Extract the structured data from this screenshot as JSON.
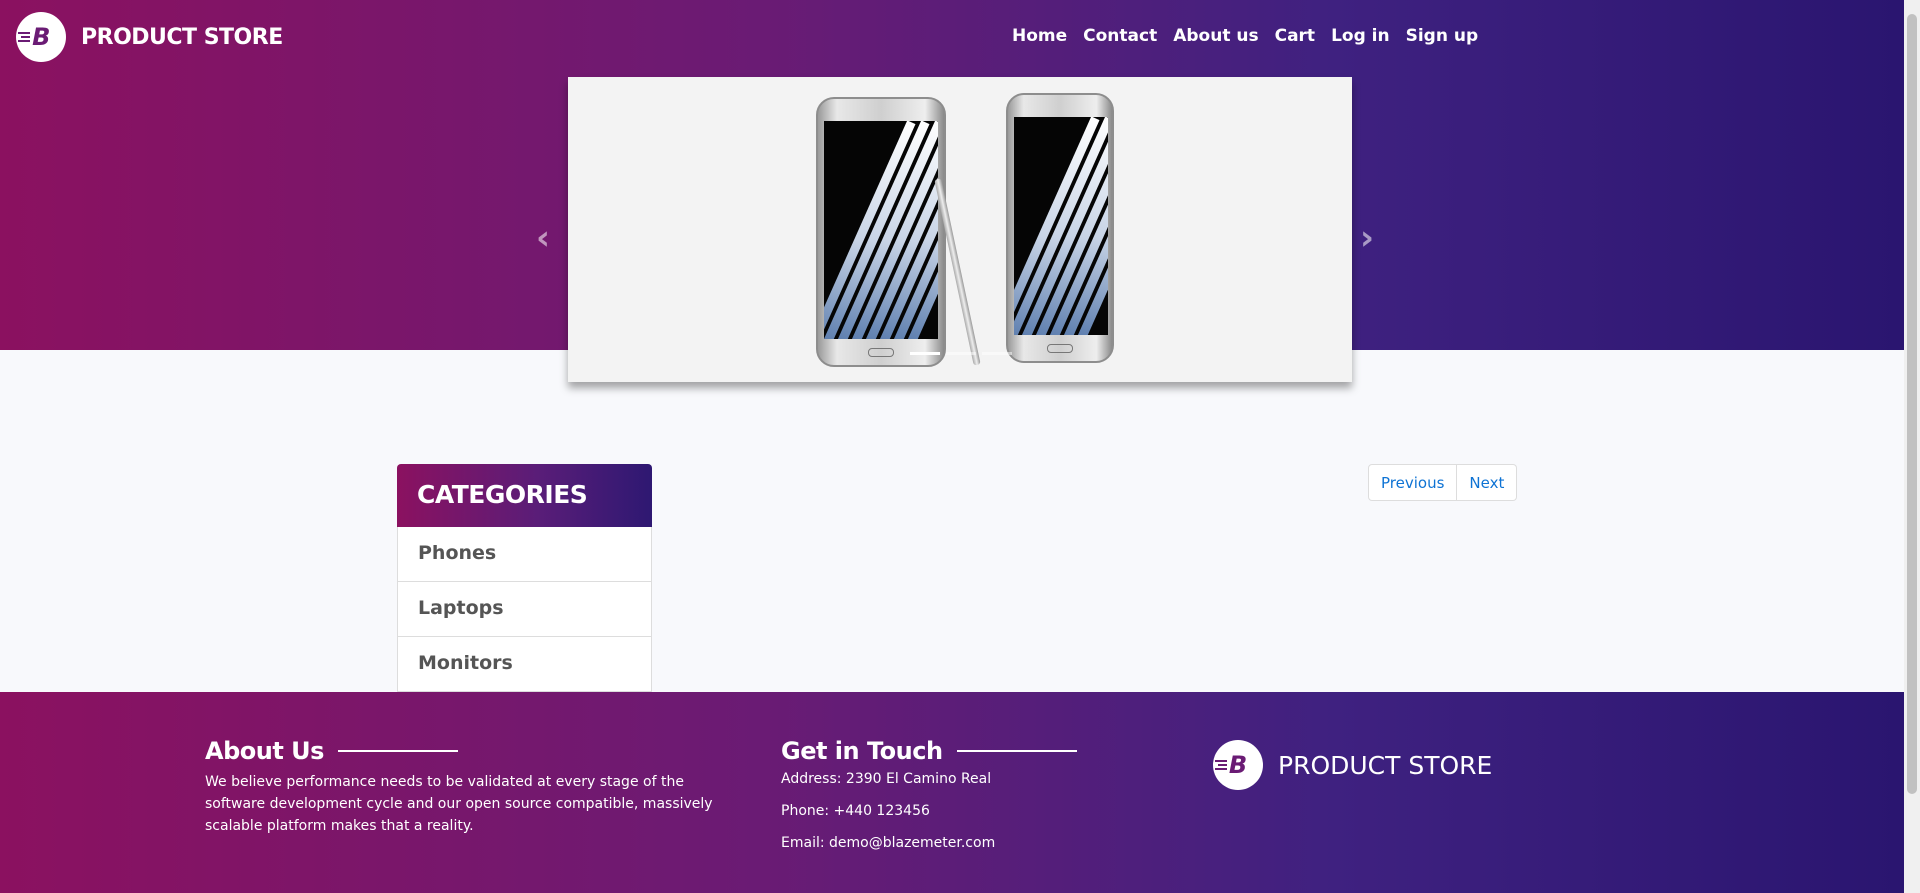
{
  "header": {
    "brand": "PRODUCT STORE",
    "logo_letter": "B",
    "nav": [
      "Home",
      "Contact",
      "About us",
      "Cart",
      "Log in",
      "Sign up"
    ]
  },
  "carousel": {
    "prev_icon": "chevron-left-icon",
    "next_icon": "chevron-right-icon",
    "prev_glyph": "‹",
    "next_glyph": "›"
  },
  "categories": {
    "title": "CATEGORIES",
    "items": [
      "Phones",
      "Laptops",
      "Monitors"
    ]
  },
  "pagination": {
    "previous": "Previous",
    "next": "Next"
  },
  "footer": {
    "about_title": "About Us",
    "about_text": "We believe performance needs to be validated at every stage of the software development cycle and our open source compatible, massively scalable platform makes that a reality.",
    "contact_title": "Get in Touch",
    "address": "Address: 2390 El Camino Real",
    "phone": "Phone: +440 123456",
    "email": "Email: demo@blazemeter.com",
    "brand": "PRODUCT STORE"
  },
  "colors": {
    "gradient_start": "#8b1160",
    "gradient_end": "#2a1570",
    "link": "#0e73d4"
  }
}
